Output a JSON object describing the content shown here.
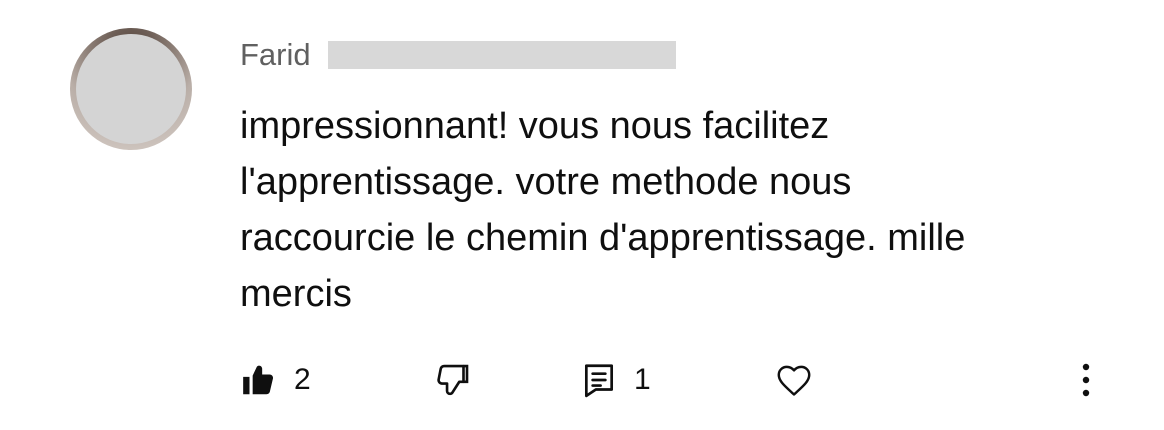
{
  "comment": {
    "author_visible": "Farid",
    "text": "impressionnant! vous nous facilitez\nl'apprentissage. votre methode nous\nraccourcie le chemin d'apprentissage. mille\nmercis"
  },
  "actions": {
    "likes": "2",
    "replies": "1"
  },
  "icons": {
    "like": "thumb-up-filled-icon",
    "dislike": "thumb-down-outline-icon",
    "reply": "comment-icon",
    "heart": "heart-outline-icon",
    "more": "more-vertical-icon"
  },
  "colors": {
    "text": "#0f0f0f",
    "secondary_text": "#606060",
    "redaction": "#d8d8d8"
  }
}
